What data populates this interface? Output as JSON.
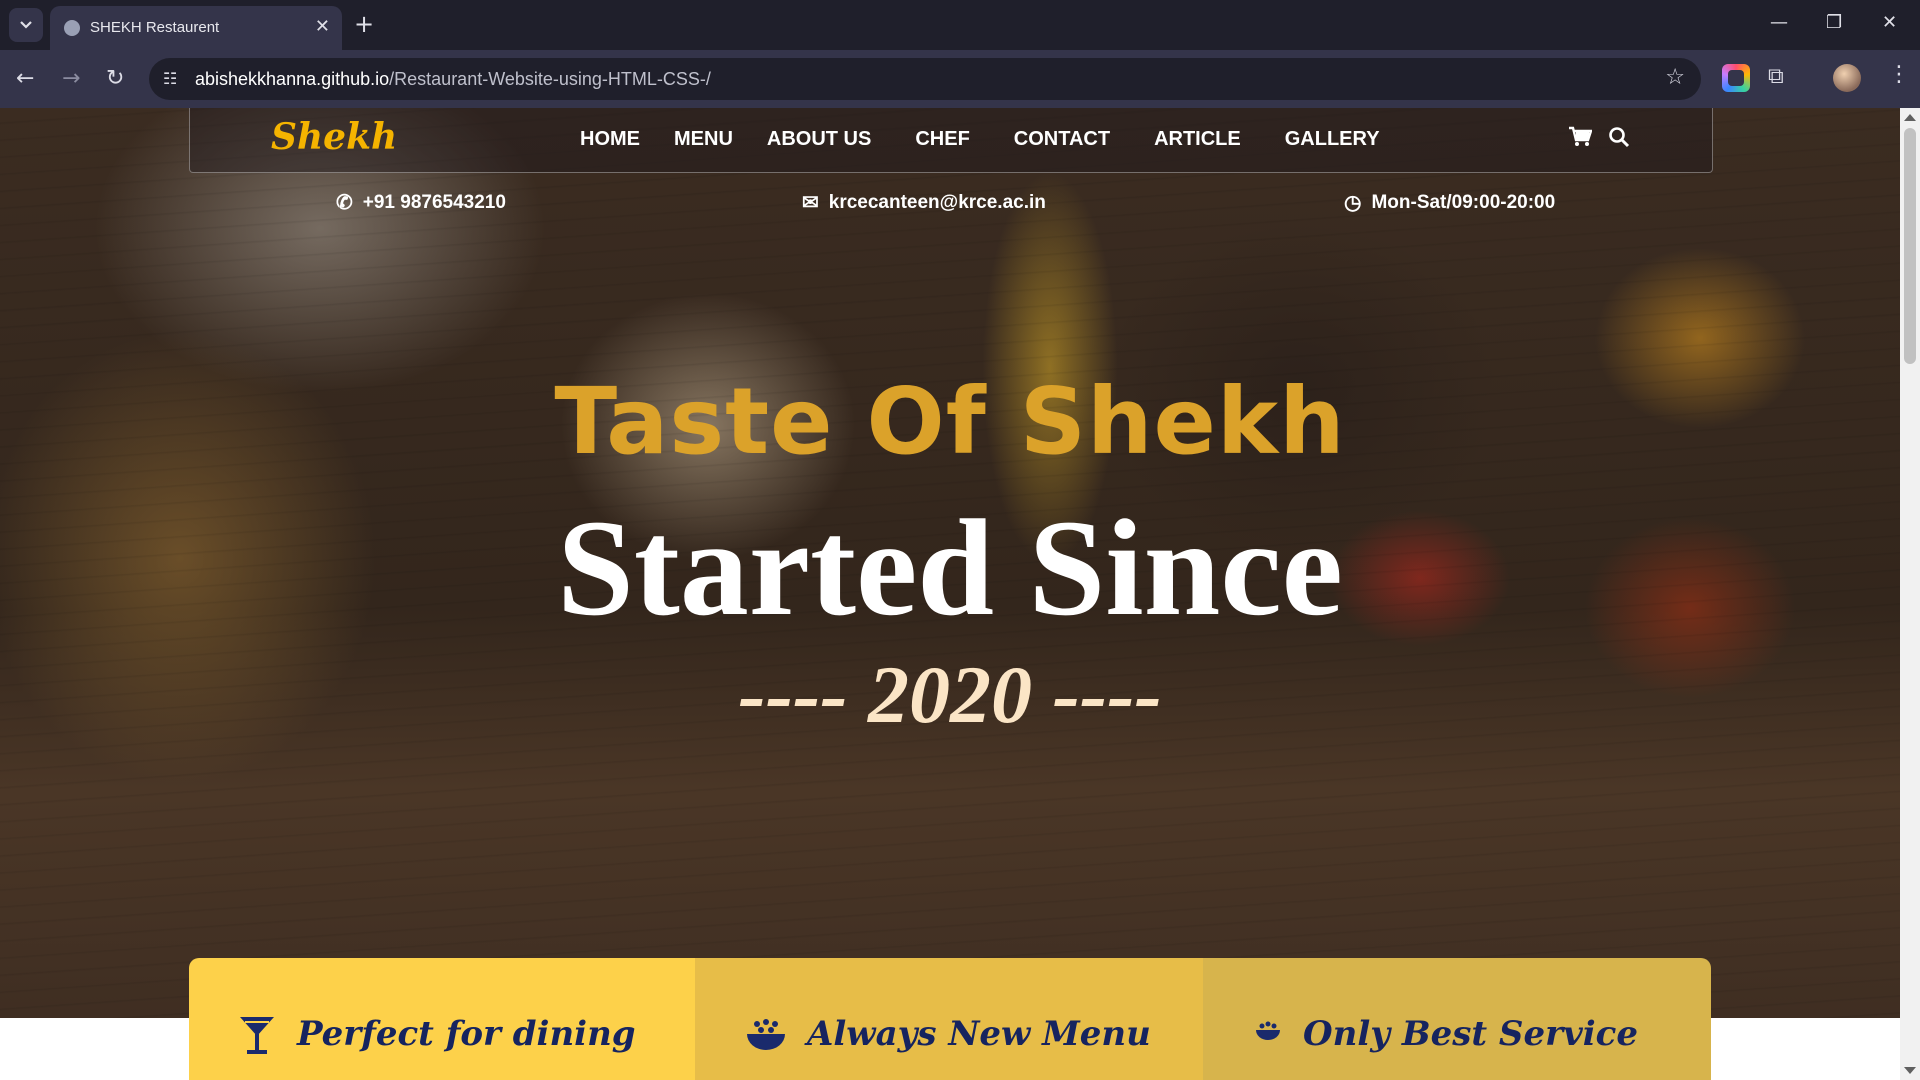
{
  "browser": {
    "tab_title": "SHEKH Restaurent",
    "new_tab_symbol": "+",
    "url_host": "abishekkhanna.github.io",
    "url_path": "/Restaurant-Website-using-HTML-CSS-/",
    "icons": [
      "tab-list-icon",
      "favicon-icon",
      "close-icon",
      "back-icon",
      "forward-icon",
      "reload-icon",
      "site-info-icon",
      "bookmark-star-icon",
      "lens-icon",
      "extensions-icon",
      "profile-avatar",
      "menu-kebab-icon",
      "minimize-icon",
      "maximize-icon",
      "window-close-icon"
    ]
  },
  "navbar": {
    "brand": "Shekh",
    "links": [
      "HOME",
      "MENU",
      "ABOUT US",
      "CHEF",
      "CONTACT",
      "ARTICLE",
      "GALLERY"
    ],
    "icons": [
      "cart-icon",
      "search-icon"
    ]
  },
  "contact": {
    "phone": "+91 9876543210",
    "email": "krcecanteen@krce.ac.in",
    "hours": "Mon-Sat/09:00-20:00"
  },
  "hero": {
    "line1": "Taste Of Shekh",
    "line2": "Started Since",
    "line3": "---- 2020 ----"
  },
  "features": [
    {
      "icon": "cocktail-icon",
      "label": "Perfect for dining",
      "color": "#fdd14a"
    },
    {
      "icon": "bowl-icon",
      "label": "Always New Menu",
      "color": "#e7bd48"
    },
    {
      "icon": "dish-icon",
      "label": "Only Best Service",
      "color": "#d7b44c"
    }
  ],
  "colors": {
    "brand": "#f5b400",
    "headline_gold": "#dba22a",
    "year": "#fbe5c6",
    "feature_text": "#16245f"
  }
}
